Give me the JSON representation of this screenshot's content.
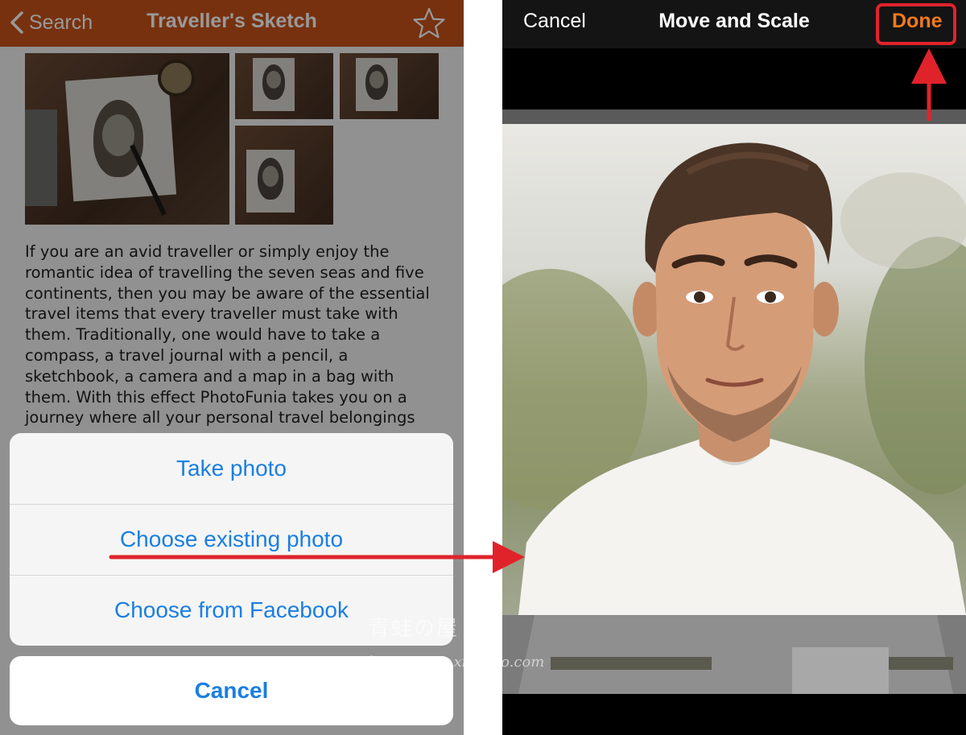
{
  "left": {
    "nav": {
      "back_label": "Search",
      "title": "Traveller's Sketch",
      "bar_color": "#c6531a",
      "back_icon": "chevron-left-icon",
      "favorite_icon": "star-icon"
    },
    "description": "If you are an avid traveller or simply enjoy the romantic idea of travelling the seven seas and five continents, then you may be aware of the essential travel items that every traveller must take with them. Traditionally, one would have to take a compass, a travel journal with a pencil, a sketchbook, a camera and a map in a bag with them. With this effect PhotoFunia takes you on a journey where all your personal travel belongings",
    "action_sheet": {
      "items": [
        "Take photo",
        "Choose existing photo",
        "Choose from Facebook"
      ],
      "cancel": "Cancel",
      "text_color": "#1a7fe2"
    }
  },
  "right": {
    "nav": {
      "cancel": "Cancel",
      "title": "Move and Scale",
      "done": "Done",
      "done_color": "#f07a1e"
    }
  },
  "annotations": {
    "color": "#e0232b",
    "watermark_text": "青蛙の屋",
    "watermark_url": "http://www.xiaozuo.com"
  }
}
